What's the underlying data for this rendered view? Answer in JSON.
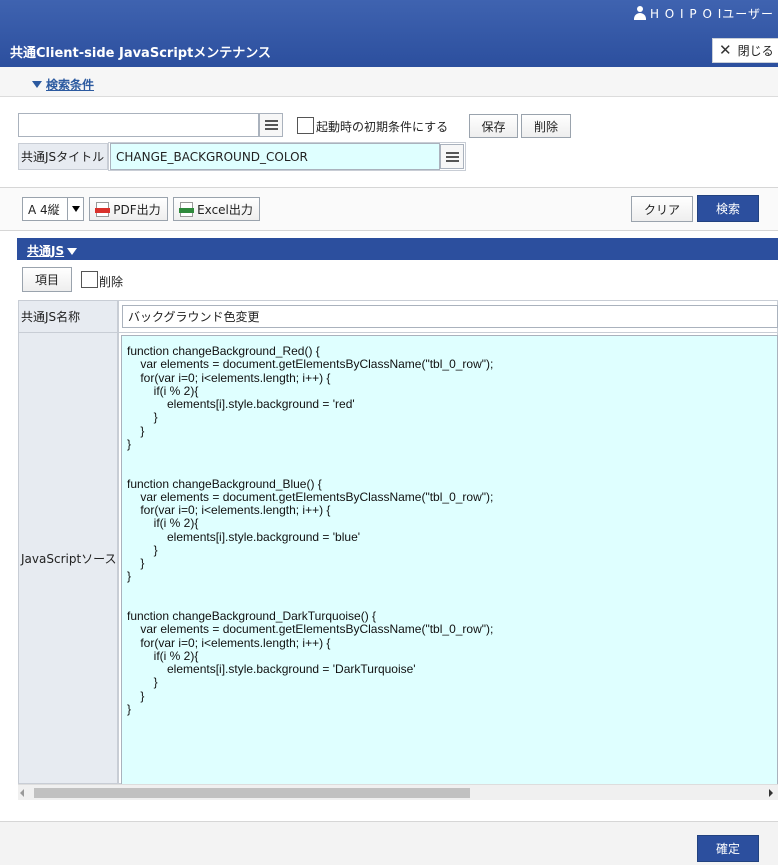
{
  "header": {
    "user_name": "H O I P O Iユーザー",
    "title": "共通Client-side JavaScriptメンテナンス",
    "close_label": "閉じる"
  },
  "search_conditions": {
    "toggle_label": "検索条件",
    "search_value": "",
    "initial_condition_checkbox_label": "起動時の初期条件にする",
    "initial_condition_checked": false,
    "save_label": "保存",
    "delete_label": "削除",
    "js_title_label": "共通JSタイトル",
    "js_title_value": "CHANGE_BACKGROUND_COLOR"
  },
  "toolbar": {
    "paper_size": "A 4縦",
    "pdf_label": "PDF出力",
    "excel_label": "Excel出力",
    "clear_label": "クリア",
    "search_label": "検索"
  },
  "section": {
    "title": "共通JS",
    "item_button_label": "項目",
    "delete_checkbox_label": "削除",
    "delete_checked": false,
    "name_label": "共通JS名称",
    "name_value": "バックグラウンド色変更",
    "source_label": "JavaScriptソース",
    "source_lines": [
      "function changeBackground_Red() {",
      "    var elements = document.getElementsByClassName(\"tbl_0_row\");",
      "    for(var i=0; i<elements.length; i++) {",
      "        if(i % 2){",
      "            elements[i].style.background = 'red'",
      "        }",
      "    }",
      "}",
      "",
      "",
      "function changeBackground_Blue() {",
      "    var elements = document.getElementsByClassName(\"tbl_0_row\");",
      "    for(var i=0; i<elements.length; i++) {",
      "        if(i % 2){",
      "            elements[i].style.background = 'blue'",
      "        }",
      "    }",
      "}",
      "",
      "",
      "function changeBackground_DarkTurquoise() {",
      "    var elements = document.getElementsByClassName(\"tbl_0_row\");",
      "    for(var i=0; i<elements.length; i++) {",
      "        if(i % 2){",
      "            elements[i].style.background = 'DarkTurquoise'",
      "        }",
      "    }",
      "}"
    ]
  },
  "footer": {
    "confirm_label": "確定"
  },
  "colors": {
    "brand_blue": "#2c4f9e",
    "input_cyan": "#dfffff",
    "label_gray": "#e7ebf1"
  },
  "icons": [
    "user-icon",
    "close-icon",
    "chevron-down-icon",
    "list-icon",
    "pdf-icon",
    "excel-icon",
    "select-arrow-icon"
  ]
}
